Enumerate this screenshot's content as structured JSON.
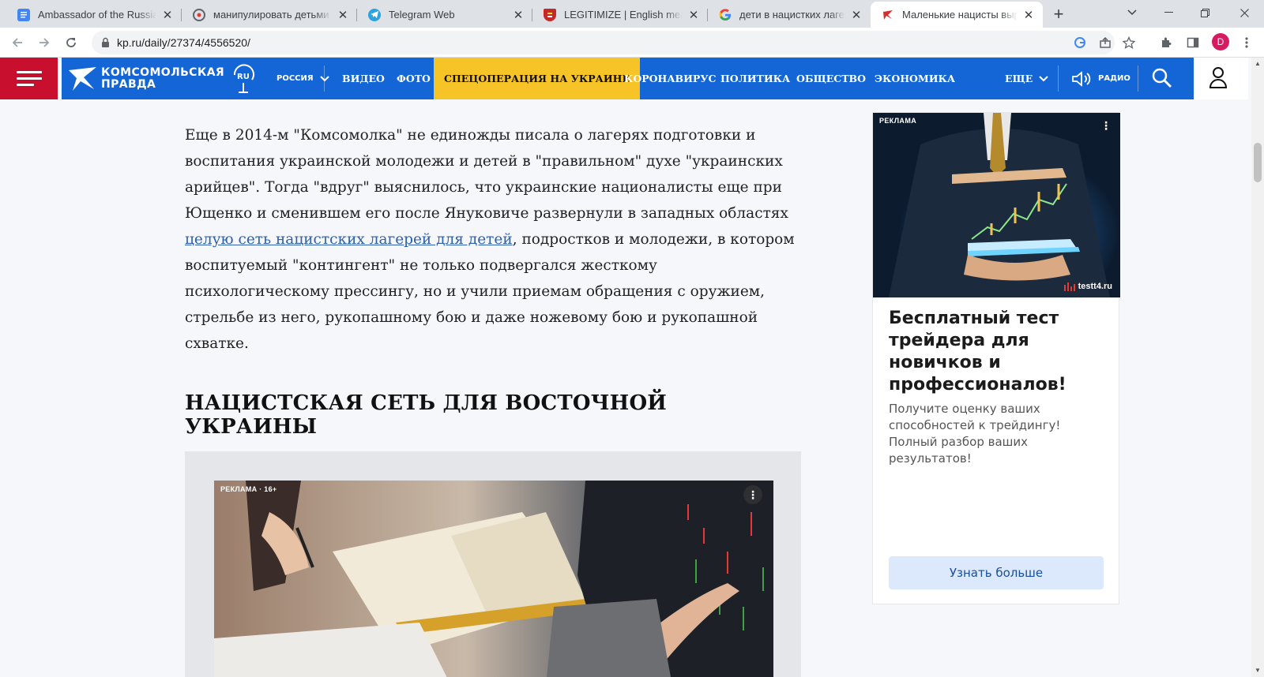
{
  "browser": {
    "tabs": [
      {
        "title": "Ambassador of the Russian",
        "icon": "docs-icon",
        "active": false
      },
      {
        "title": "манипулировать детьми -",
        "icon": "site-icon",
        "active": false
      },
      {
        "title": "Telegram Web",
        "icon": "telegram-icon",
        "active": false
      },
      {
        "title": "LEGITIMIZE | English meanin",
        "icon": "cambridge-icon",
        "active": false
      },
      {
        "title": "дети в нацистких лагерях п",
        "icon": "google-icon",
        "active": false
      },
      {
        "title": "Маленькие нацисты выро",
        "icon": "kp-icon",
        "active": true
      }
    ],
    "close_glyph": "✕",
    "new_tab_glyph": "+",
    "url": "kp.ru/daily/27374/4556520/",
    "profile_initial": "D"
  },
  "site": {
    "logo_line1": "КОМСОМОЛЬСКАЯ",
    "logo_line2": "ПРАВДА",
    "logo_ru": "RU",
    "region": "РОССИЯ",
    "nav": [
      "ВИДЕО",
      "ФОТО",
      "СПЕЦОПЕРАЦИЯ НА УКРАИНЕ",
      "КОРОНАВИРУС",
      "ПОЛИТИКА",
      "ОБЩЕСТВО",
      "ЭКОНОМИКА"
    ],
    "more": "ЕЩЕ",
    "radio": "РАДИО",
    "colors": {
      "blue": "#1466d6",
      "red": "#c8102e",
      "highlight": "#f6c426"
    }
  },
  "article": {
    "para_before_link": "Еще в 2014-м \"Комсомолка\" не единожды писала о лагерях подготовки и воспитания украинской молодежи и детей в \"правильном\" духе \"украинских арийцев\". Тогда \"вдруг\" выяснилось, что украинские националисты еще при Ющенко и сменившем его после Януковиче развернули в западных областях ",
    "link_text": "целую сеть нацистских лагерей для детей",
    "para_after_link": ", подростков и молодежи, в котором воспитуемый \"контингент\" не только подвергался жесткому психологическому прессингу, но и учили приемам обращения с оружием, стрельбе из него, рукопашному бою и даже ножевому бою и рукопашной схватке.",
    "section_title": "НАЦИСТСКАЯ СЕТЬ ДЛЯ ВОСТОЧНОЙ УКРАИНЫ",
    "ad_label": "РЕКЛАМА · 16+"
  },
  "side_ad": {
    "label": "РЕКЛАМА",
    "brand": "testt4.ru",
    "headline": "Бесплатный тест трейдера для новичков и профессионалов!",
    "description": "Получите оценку ваших способностей к трейдингу! Полный разбор ваших результатов!",
    "cta": "Узнать больше"
  }
}
